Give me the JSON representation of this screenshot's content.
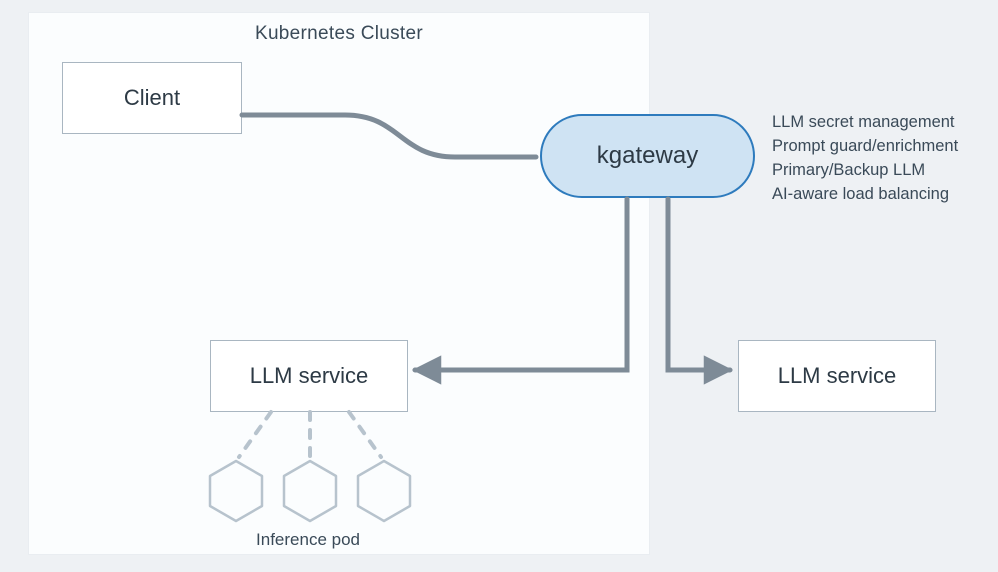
{
  "cluster": {
    "title": "Kubernetes Cluster"
  },
  "client": {
    "label": "Client"
  },
  "gateway": {
    "label": "kgateway"
  },
  "features": {
    "f1": "LLM secret management",
    "f2": "Prompt guard/enrichment",
    "f3": "Primary/Backup LLM",
    "f4": "AI-aware load balancing"
  },
  "llm1": {
    "label": "LLM service"
  },
  "llm2": {
    "label": "LLM service"
  },
  "pods": {
    "label": "Inference pod"
  }
}
